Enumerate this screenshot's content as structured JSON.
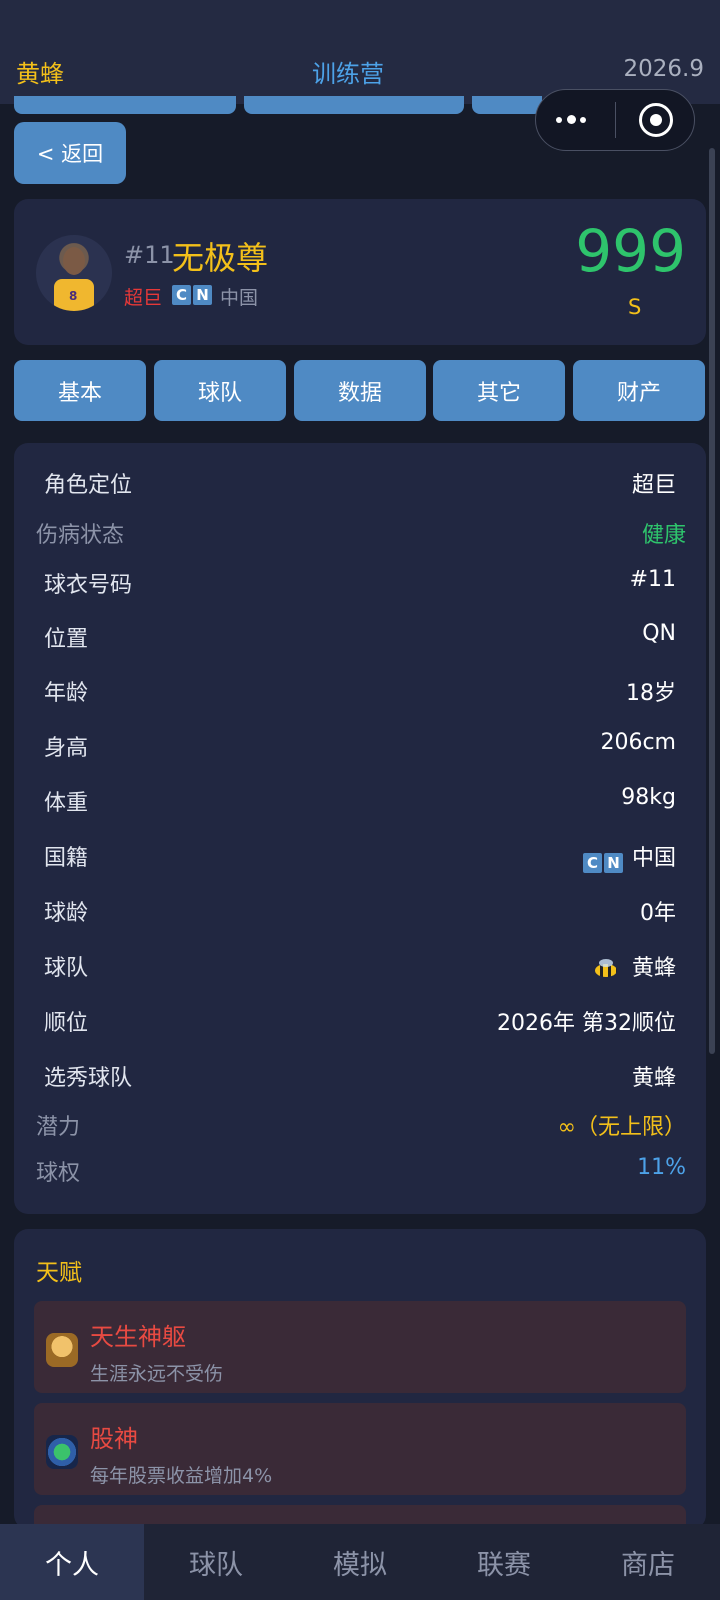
{
  "header": {
    "team": "黄蜂",
    "title": "训练营",
    "date": "2026.9"
  },
  "back_label": "< 返回",
  "player": {
    "number": "#11",
    "name": "无极尊",
    "role": "超巨",
    "flag_letters": [
      "C",
      "N"
    ],
    "country": "中国",
    "score": "999",
    "grade": "S"
  },
  "tabs": [
    "基本",
    "球队",
    "数据",
    "其它",
    "财产"
  ],
  "info": {
    "role": {
      "label": "角色定位",
      "value": "超巨"
    },
    "injury": {
      "label": "伤病状态",
      "value": "健康"
    },
    "jersey": {
      "label": "球衣号码",
      "value": "#11"
    },
    "position": {
      "label": "位置",
      "value": "QN"
    },
    "age": {
      "label": "年龄",
      "value": "18岁"
    },
    "height": {
      "label": "身高",
      "value": "206cm"
    },
    "weight": {
      "label": "体重",
      "value": "98kg"
    },
    "nationality": {
      "label": "国籍",
      "value": "中国"
    },
    "experience": {
      "label": "球龄",
      "value": "0年"
    },
    "team": {
      "label": "球队",
      "value": "黄蜂"
    },
    "draft": {
      "label": "顺位",
      "value": "2026年 第32顺位"
    },
    "draft_team": {
      "label": "选秀球队",
      "value": "黄蜂"
    },
    "potential": {
      "label": "潜力",
      "value": "∞（无上限）"
    },
    "usage": {
      "label": "球权",
      "value": "11%"
    }
  },
  "talents": {
    "title": "天赋",
    "items": [
      {
        "name": "天生神躯",
        "desc": "生涯永远不受伤",
        "icon": "golden-body-icon"
      },
      {
        "name": "股神",
        "desc": "每年股票收益增加4%",
        "icon": "coin-icon"
      }
    ]
  },
  "bottom_nav": [
    "个人",
    "球队",
    "模拟",
    "联赛",
    "商店"
  ],
  "colors": {
    "gold": "#f3c01a",
    "blue": "#4f8ac4",
    "green": "#2ec46c",
    "red": "#e84a42"
  }
}
